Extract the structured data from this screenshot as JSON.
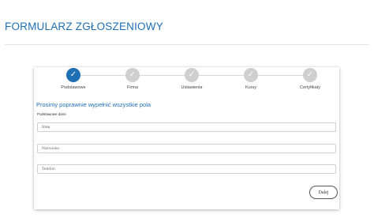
{
  "page": {
    "title": "FORMULARZ ZGŁOSZENIOWY"
  },
  "steps": [
    {
      "label": "Podstawowe",
      "active": true
    },
    {
      "label": "Firma",
      "active": false
    },
    {
      "label": "Ustawienia",
      "active": false
    },
    {
      "label": "Kursy",
      "active": false
    },
    {
      "label": "Certyfikaty",
      "active": false
    }
  ],
  "step_check": "✓",
  "form": {
    "heading": "Prosimy poprawnie wypełnić wszystkie pola",
    "section_label": "Podstawowe dane",
    "fields": {
      "first_name": {
        "placeholder": "Imię",
        "value": ""
      },
      "last_name": {
        "placeholder": "Nazwisko",
        "value": ""
      },
      "phone": {
        "placeholder": "Telefon",
        "value": ""
      }
    },
    "next_label": "Dalej"
  },
  "colors": {
    "accent": "#1f6fb5",
    "step_inactive": "#cfcfcf"
  }
}
